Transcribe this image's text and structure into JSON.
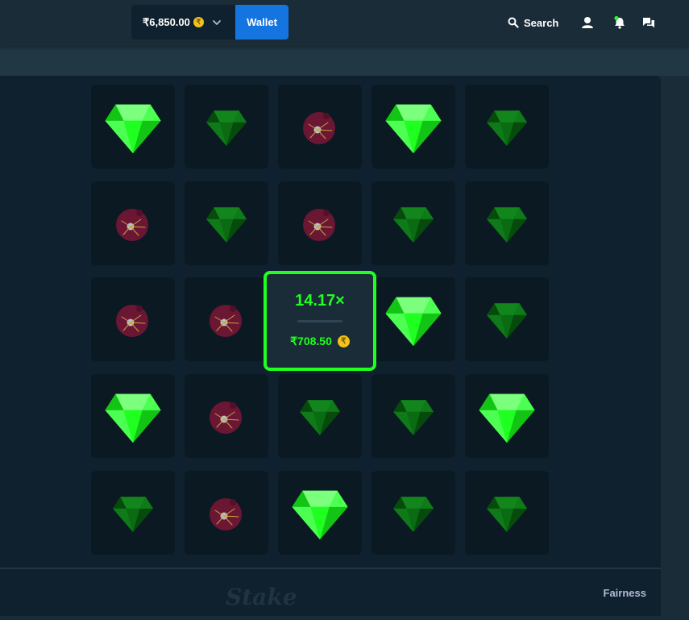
{
  "header": {
    "balance": "₹6,850.00",
    "currency_symbol": "₹",
    "wallet_label": "Wallet",
    "search_label": "Search",
    "icons": [
      "user-icon",
      "notifications-icon",
      "chat-icon"
    ]
  },
  "win": {
    "multiplier": "14.17×",
    "payout": "₹708.50"
  },
  "footer": {
    "brand": "Stake",
    "fairness_label": "Fairness"
  },
  "board": {
    "rows": [
      [
        "gem-revealed",
        "gem",
        "mine",
        "gem-revealed",
        "gem"
      ],
      [
        "mine",
        "gem",
        "mine",
        "gem",
        "gem"
      ],
      [
        "mine",
        "mine",
        "gem-revealed",
        "gem-revealed",
        "gem"
      ],
      [
        "gem-revealed",
        "mine",
        "gem",
        "gem",
        "gem-revealed"
      ],
      [
        "gem",
        "mine",
        "gem-revealed",
        "gem",
        "gem"
      ]
    ]
  },
  "colors": {
    "accent_green": "#1fff20",
    "wallet_blue": "#1475e1",
    "coin_gold": "#f4c21b",
    "mine_red": "#6b1633"
  }
}
